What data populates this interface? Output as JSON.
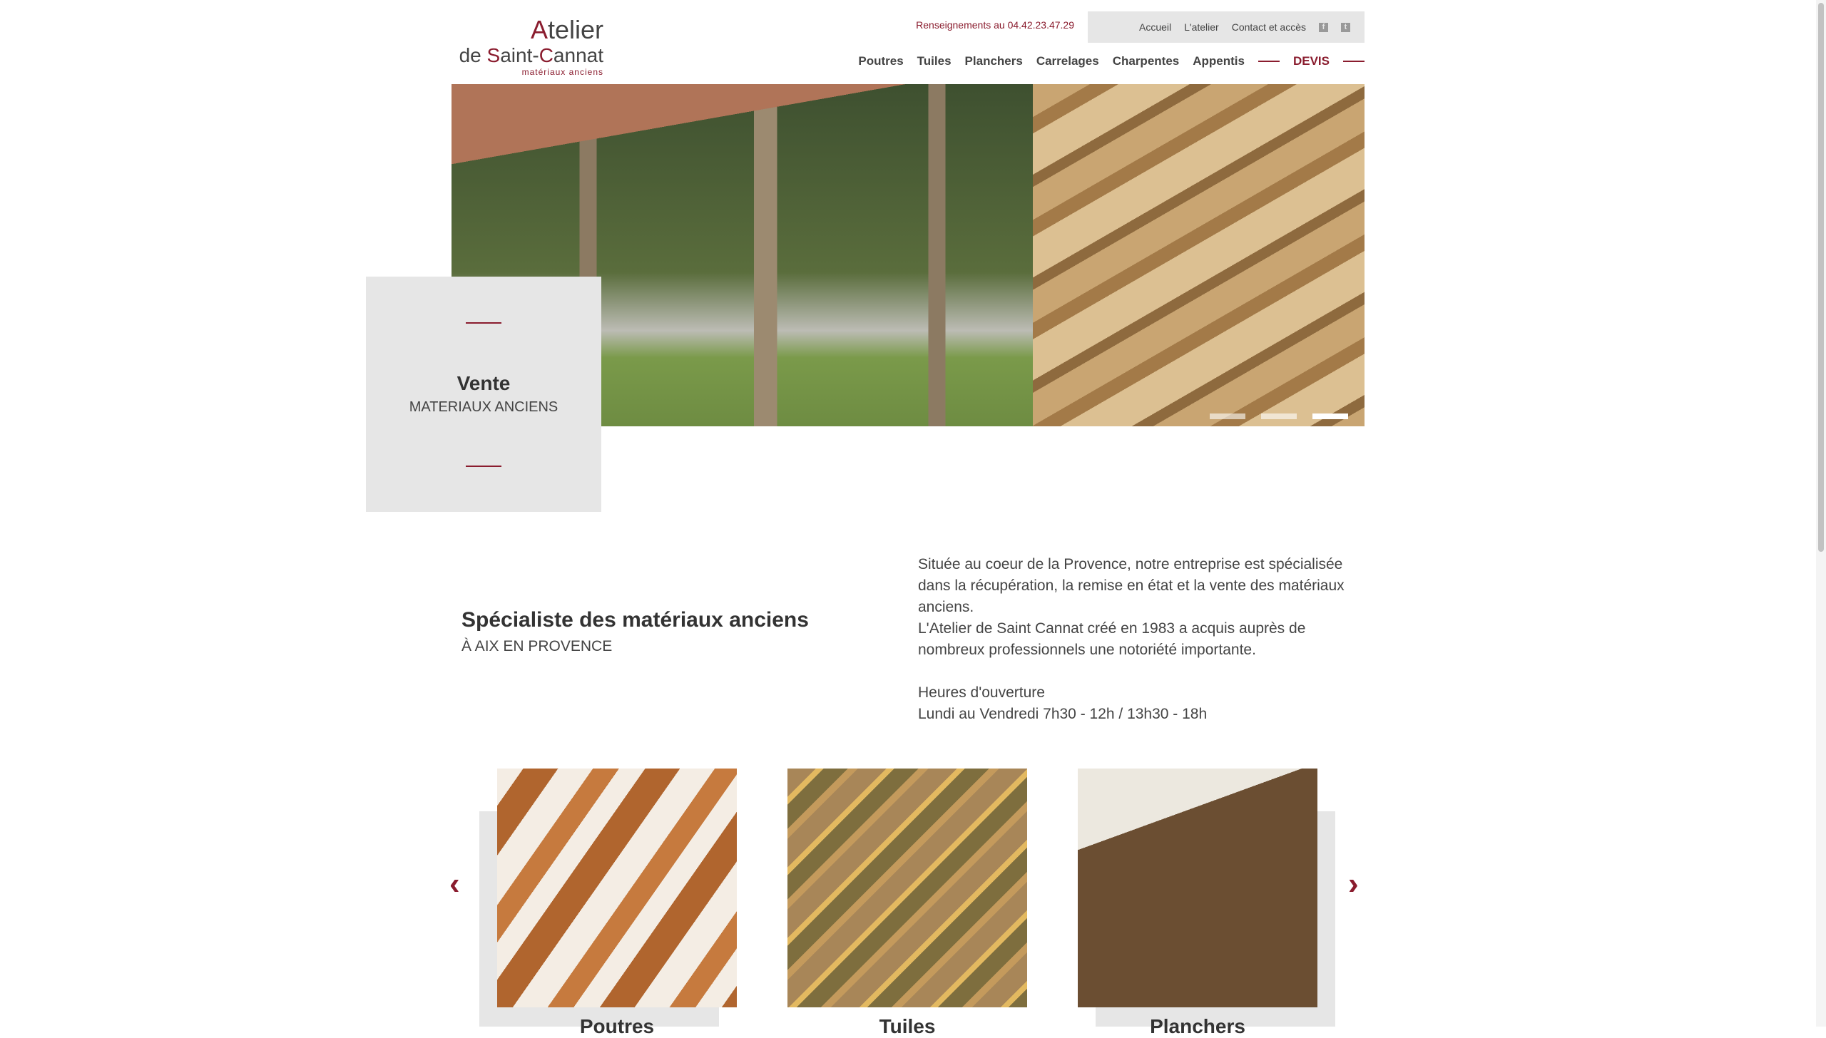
{
  "logo": {
    "line1_initial": "A",
    "line1_rest": "telier",
    "line2_a": "de ",
    "line2_s": "S",
    "line2_b": "aint-",
    "line2_c": "C",
    "line2_d": "annat",
    "tagline": "matériaux anciens"
  },
  "header": {
    "phone": "Renseignements au 04.42.23.47.29",
    "top_links": [
      "Accueil",
      "L'atelier",
      "Contact et accès"
    ],
    "social": [
      "facebook-icon",
      "twitter-icon"
    ]
  },
  "nav": {
    "items": [
      "Poutres",
      "Tuiles",
      "Planchers",
      "Carrelages",
      "Charpentes",
      "Appentis"
    ],
    "devis": "DEVIS"
  },
  "hero": {
    "title": "Vente",
    "subtitle": "MATERIAUX ANCIENS",
    "slides": 3,
    "active_slide": 3
  },
  "intro": {
    "heading": "Spécialiste des matériaux anciens",
    "subheading": "À AIX EN PROVENCE",
    "p1": "Située au coeur de la Provence, notre entreprise est spécialisée dans la récupération, la remise en état et la vente des matériaux anciens.",
    "p2": "L'Atelier de Saint Cannat créé en 1983 a acquis auprès de nombreux professionnels une notoriété importante.",
    "hours_title": "Heures d'ouverture",
    "hours": "Lundi au Vendredi 7h30 - 12h / 13h30 - 18h"
  },
  "products": [
    {
      "label": "Poutres"
    },
    {
      "label": "Tuiles"
    },
    {
      "label": "Planchers"
    }
  ],
  "carousel": {
    "prev": "‹",
    "next": "›"
  },
  "colors": {
    "accent": "#8a1c2e",
    "panel": "#e6e6e6"
  }
}
